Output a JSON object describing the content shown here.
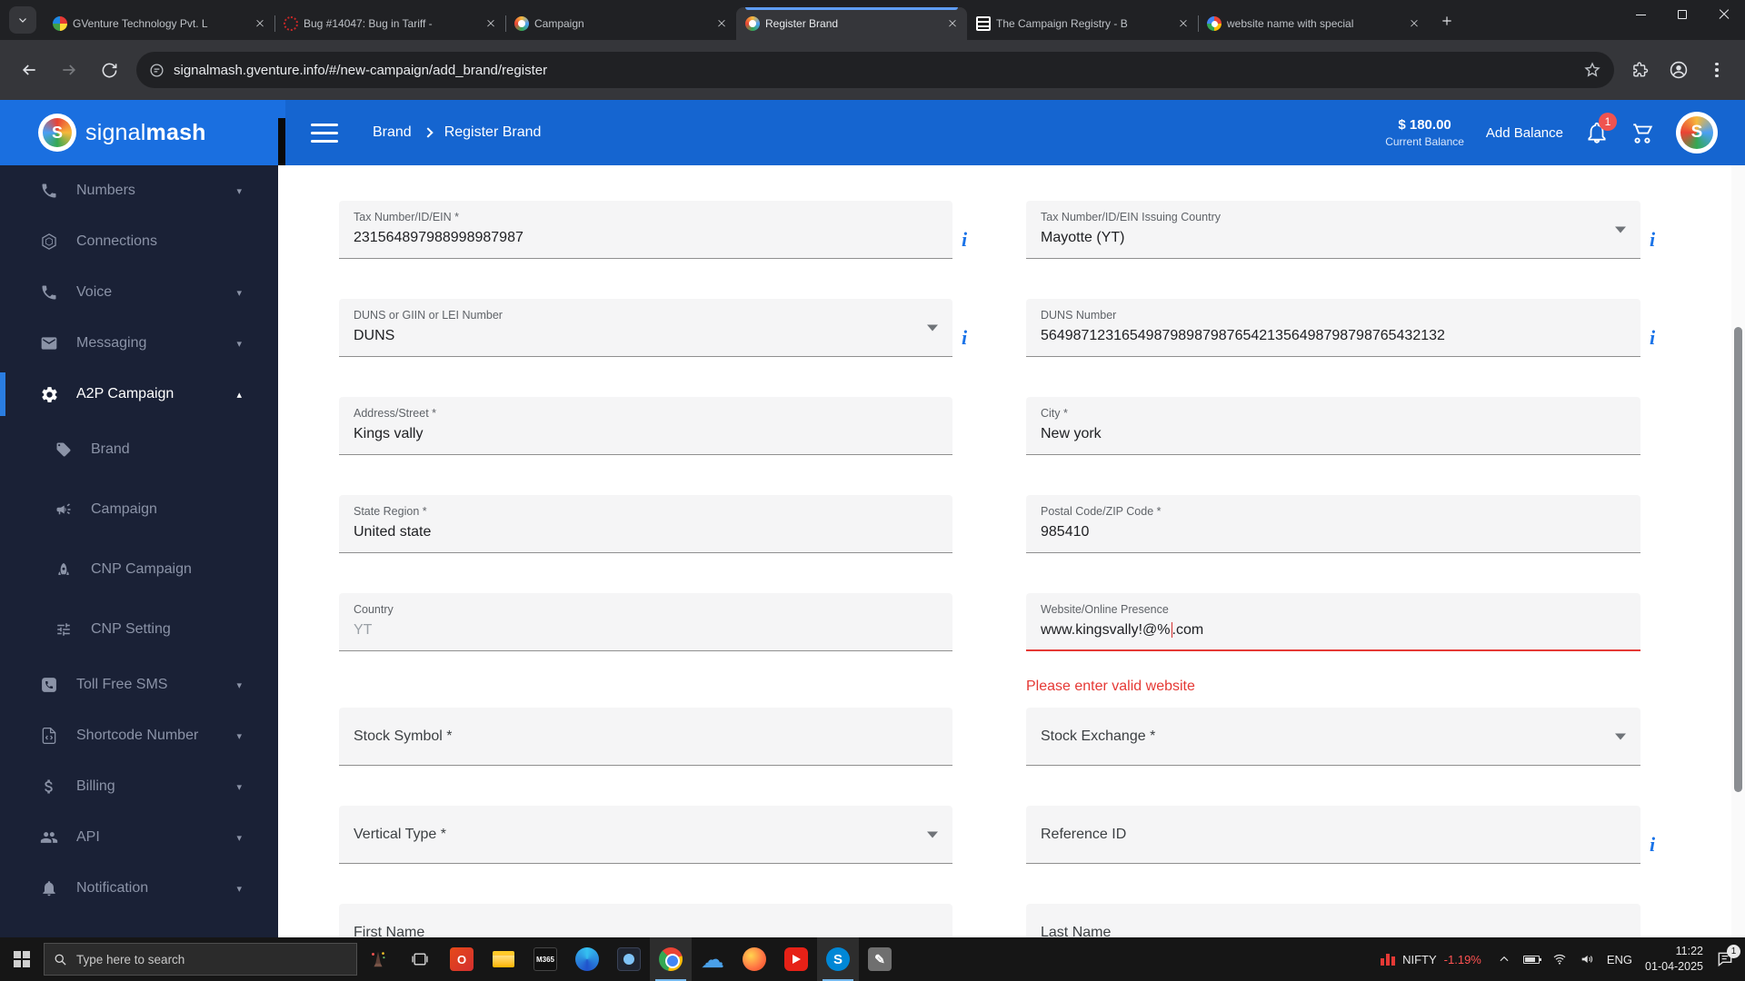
{
  "colors": {
    "accent_blue": "#1a73e8",
    "header_blue": "#1565d0",
    "sidebar_bg": "#1a2136",
    "error_red": "#e53935",
    "taskbar_bg": "#161616"
  },
  "browser": {
    "tabs": [
      {
        "title": "GVenture Technology Pvt. L",
        "favicon": "gventure-favicon"
      },
      {
        "title": "Bug #14047: Bug in Tariff -",
        "favicon": "redmine-favicon"
      },
      {
        "title": "Campaign",
        "favicon": "signalmash-favicon"
      },
      {
        "title": "Register Brand",
        "favicon": "signalmash-favicon"
      },
      {
        "title": "The Campaign Registry - B",
        "favicon": "campaign-registry-favicon"
      },
      {
        "title": "website name with special",
        "favicon": "google-favicon"
      }
    ],
    "url": "signalmash.gventure.info/#/new-campaign/add_brand/register"
  },
  "header": {
    "logo_regular": "signal",
    "logo_bold": "mash",
    "logo_letter": "S",
    "breadcrumb_1": "Brand",
    "breadcrumb_2": "Register Brand",
    "balance_amount": "$ 180.00",
    "balance_label": "Current Balance",
    "add_balance_label": "Add Balance",
    "bell_badge": "1",
    "avatar_letter": "S"
  },
  "sidebar": {
    "items": [
      {
        "label": "Numbers"
      },
      {
        "label": "Connections"
      },
      {
        "label": "Voice"
      },
      {
        "label": "Messaging"
      },
      {
        "label": "A2P Campaign"
      },
      {
        "label": "Brand"
      },
      {
        "label": "Campaign"
      },
      {
        "label": "CNP Campaign"
      },
      {
        "label": "CNP Setting"
      },
      {
        "label": "Toll Free SMS"
      },
      {
        "label": "Shortcode Number"
      },
      {
        "label": "Billing"
      },
      {
        "label": "API"
      },
      {
        "label": "Notification"
      }
    ]
  },
  "form": {
    "error_message": "Please enter valid website",
    "rows": [
      {
        "left": {
          "label": "Tax Number/ID/EIN *",
          "value": "231564897988998987987"
        },
        "right": {
          "label": "Tax Number/ID/EIN Issuing Country",
          "value": "Mayotte (YT)"
        }
      },
      {
        "left": {
          "label": "DUNS or GIIN or LEI Number",
          "value": "DUNS"
        },
        "right": {
          "label": "DUNS Number",
          "value": "56498712316549879898798765421356498798798765432132"
        }
      },
      {
        "left": {
          "label": "Address/Street *",
          "value": "Kings vally"
        },
        "right": {
          "label": "City *",
          "value": "New york"
        }
      },
      {
        "left": {
          "label": "State Region *",
          "value": "United state"
        },
        "right": {
          "label": "Postal Code/ZIP Code *",
          "value": "985410"
        }
      },
      {
        "left": {
          "label": "Country",
          "value": "YT"
        },
        "right": {
          "label": "Website/Online Presence",
          "value": "www.kingsvally!@%",
          "value_tail": ".com"
        }
      },
      {
        "left": {
          "label": "Stock Symbol *"
        },
        "right": {
          "label": "Stock Exchange *"
        }
      },
      {
        "left": {
          "label": "Vertical Type *"
        },
        "right": {
          "label": "Reference ID"
        }
      },
      {
        "left": {
          "label": "First Name"
        },
        "right": {
          "label": "Last Name"
        }
      }
    ]
  },
  "taskbar": {
    "search_placeholder": "Type here to search",
    "m365_label": "M365",
    "skype_letter": "S",
    "whiteboard_glyph": "✎",
    "onedrive_glyph": "☁",
    "office_letter": "O",
    "ticker": "NIFTY",
    "ticker_change": "-1.19%",
    "language": "ENG",
    "time": "11:22",
    "date": "01-04-2025",
    "action_badge": "1"
  }
}
